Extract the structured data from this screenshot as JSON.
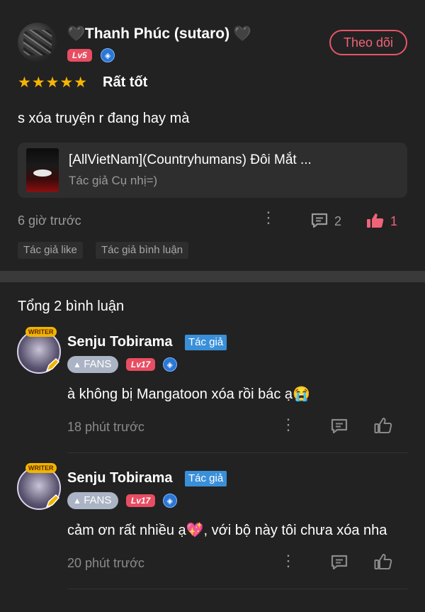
{
  "review": {
    "username": "Thanh Phúc (sutaro)",
    "heart_left": "🖤",
    "heart_right": "🖤",
    "level": "Lv5",
    "follow_label": "Theo dõi",
    "stars": "★★★★★",
    "rating_label": "Rất tốt",
    "text": "s xóa truyện r đang hay mà",
    "book": {
      "title": "[AllVietNam](Countryhumans) Đôi Mắt ...",
      "author": "Tác giả Cụ nhị=)"
    },
    "time": "6 giờ trước",
    "comment_count": "2",
    "like_count": "1",
    "tags": [
      "Tác giả like",
      "Tác giả bình luận"
    ]
  },
  "comments_total": "Tổng 2 bình luận",
  "comments": [
    {
      "name": "Senju Tobirama",
      "author_tag": "Tác giả",
      "badge": "WRITER",
      "fans": "FANS",
      "level": "Lv17",
      "text": "à không bị Mangatoon xóa rồi bác ạ😭",
      "time": "18 phút trước"
    },
    {
      "name": "Senju Tobirama",
      "author_tag": "Tác giả",
      "badge": "WRITER",
      "fans": "FANS",
      "level": "Lv17",
      "text": "cảm ơn rất nhiều ạ💖, với bộ này tôi chưa xóa nha",
      "time": "20 phút trước"
    }
  ],
  "colors": {
    "background": "#222222",
    "accent": "#e8556a",
    "star": "#f7b500",
    "author_tag": "#3a8fd9"
  }
}
